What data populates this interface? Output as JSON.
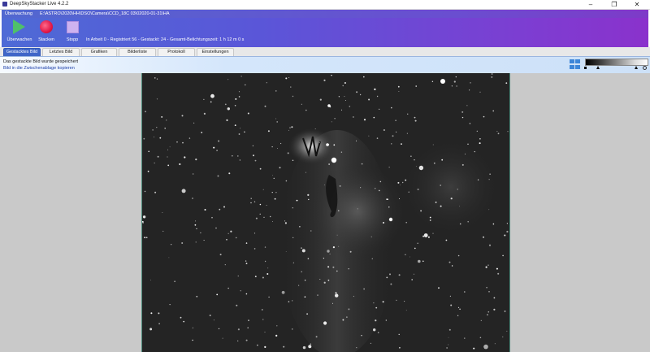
{
  "window": {
    "title": "DeepSkyStacker Live 4.2.2",
    "controls": [
      "–",
      "❐",
      "✕"
    ]
  },
  "toolbar": {
    "monitor_label": "Überwachung",
    "monitor_path": "E:\\ASTRO\\2020\\HH\\DSO\\Camera\\CCD_18C 03\\02020-01-31\\HA",
    "buttons": {
      "monitor": "Überwachen",
      "stack": "Stacken",
      "stop": "Stopp"
    },
    "status": "In Arbeit 0 - Registriert 56 - Gestackt: 24 - Gesamt-Belichtungszeit: 1 h 12 m 0 s"
  },
  "tabs": [
    {
      "label": "Gestacktes Bild",
      "active": true
    },
    {
      "label": "Letztes Bild",
      "active": false
    },
    {
      "label": "Grafiken",
      "active": false
    },
    {
      "label": "Bilderliste",
      "active": false
    },
    {
      "label": "Protokoll",
      "active": false
    },
    {
      "label": "Einstellungen",
      "active": false
    }
  ],
  "info": {
    "line1": "Das gestackte Bild wurde gespeichert",
    "line2": "Bild in die Zwischenablage kopieren"
  },
  "image": {
    "subject": "Horsehead and Flame nebula (H-alpha stack)"
  },
  "colors": {
    "toolbar_start": "#4e6ad6",
    "toolbar_end": "#8a32cc",
    "active_tab": "#3f66c8",
    "workarea": "#c9c9c9"
  }
}
